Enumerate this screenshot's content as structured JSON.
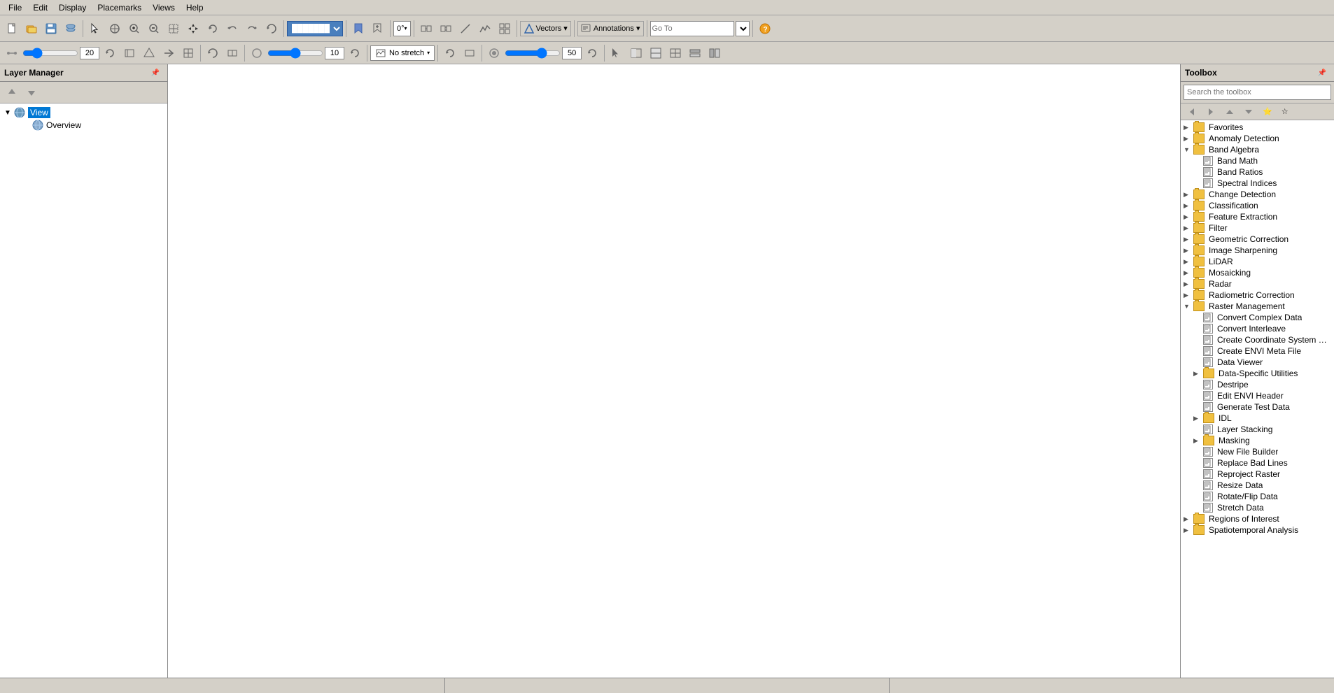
{
  "menubar": {
    "items": [
      "File",
      "Edit",
      "Display",
      "Placemarks",
      "Views",
      "Help"
    ]
  },
  "toolbar1": {
    "combo_blue": "████",
    "angle_label": "0°",
    "vectors_label": "Vectors ▾",
    "annotations_label": "Annotations ▾",
    "goto_label": "Go To",
    "goto_placeholder": ""
  },
  "toolbar2": {
    "slider1_val": "20",
    "stretch_label": "No stretch",
    "slider2_val": "10",
    "slider3_val": "50"
  },
  "layer_manager": {
    "title": "Layer Manager",
    "nodes": [
      {
        "id": "view",
        "label": "View",
        "level": 0,
        "icon": "globe",
        "selected": true,
        "expanded": true
      },
      {
        "id": "overview",
        "label": "Overview",
        "level": 1,
        "icon": "globe-small",
        "selected": false
      }
    ]
  },
  "toolbox": {
    "title": "Toolbox",
    "search_placeholder": "Search the toolbox",
    "items": [
      {
        "id": "favorites",
        "label": "Favorites",
        "level": 0,
        "type": "folder",
        "expanded": false
      },
      {
        "id": "anomaly",
        "label": "Anomaly Detection",
        "level": 0,
        "type": "folder",
        "expanded": false
      },
      {
        "id": "band_algebra",
        "label": "Band Algebra",
        "level": 0,
        "type": "folder",
        "expanded": true
      },
      {
        "id": "band_math",
        "label": "Band Math",
        "level": 1,
        "type": "tool"
      },
      {
        "id": "band_ratios",
        "label": "Band Ratios",
        "level": 1,
        "type": "tool"
      },
      {
        "id": "spectral_indices",
        "label": "Spectral Indices",
        "level": 1,
        "type": "tool"
      },
      {
        "id": "change_detection",
        "label": "Change Detection",
        "level": 0,
        "type": "folder",
        "expanded": false
      },
      {
        "id": "classification",
        "label": "Classification",
        "level": 0,
        "type": "folder",
        "expanded": false
      },
      {
        "id": "feature_extraction",
        "label": "Feature Extraction",
        "level": 0,
        "type": "folder",
        "expanded": false
      },
      {
        "id": "filter",
        "label": "Filter",
        "level": 0,
        "type": "folder",
        "expanded": false
      },
      {
        "id": "geometric_correction",
        "label": "Geometric Correction",
        "level": 0,
        "type": "folder",
        "expanded": false
      },
      {
        "id": "image_sharpening",
        "label": "Image Sharpening",
        "level": 0,
        "type": "folder",
        "expanded": false
      },
      {
        "id": "lidar",
        "label": "LiDAR",
        "level": 0,
        "type": "folder",
        "expanded": false
      },
      {
        "id": "mosaicking",
        "label": "Mosaicking",
        "level": 0,
        "type": "folder",
        "expanded": false
      },
      {
        "id": "radar",
        "label": "Radar",
        "level": 0,
        "type": "folder",
        "expanded": false
      },
      {
        "id": "radiometric_correction",
        "label": "Radiometric Correction",
        "level": 0,
        "type": "folder",
        "expanded": false
      },
      {
        "id": "raster_management",
        "label": "Raster Management",
        "level": 0,
        "type": "folder",
        "expanded": true
      },
      {
        "id": "convert_complex",
        "label": "Convert Complex Data",
        "level": 1,
        "type": "tool"
      },
      {
        "id": "convert_interleave",
        "label": "Convert Interleave",
        "level": 1,
        "type": "tool"
      },
      {
        "id": "create_coordinate",
        "label": "Create Coordinate System St...",
        "level": 1,
        "type": "tool"
      },
      {
        "id": "create_envi_meta",
        "label": "Create ENVI Meta File",
        "level": 1,
        "type": "tool"
      },
      {
        "id": "data_viewer",
        "label": "Data Viewer",
        "level": 1,
        "type": "tool"
      },
      {
        "id": "data_specific",
        "label": "Data-Specific Utilities",
        "level": 1,
        "type": "folder",
        "expanded": false
      },
      {
        "id": "destripe",
        "label": "Destripe",
        "level": 1,
        "type": "tool"
      },
      {
        "id": "edit_envi_header",
        "label": "Edit ENVI Header",
        "level": 1,
        "type": "tool"
      },
      {
        "id": "generate_test",
        "label": "Generate Test Data",
        "level": 1,
        "type": "tool"
      },
      {
        "id": "idl",
        "label": "IDL",
        "level": 1,
        "type": "folder",
        "expanded": false
      },
      {
        "id": "layer_stacking",
        "label": "Layer Stacking",
        "level": 1,
        "type": "tool"
      },
      {
        "id": "masking",
        "label": "Masking",
        "level": 1,
        "type": "folder",
        "expanded": false
      },
      {
        "id": "new_file_builder",
        "label": "New File Builder",
        "level": 1,
        "type": "tool"
      },
      {
        "id": "replace_bad_lines",
        "label": "Replace Bad Lines",
        "level": 1,
        "type": "tool"
      },
      {
        "id": "reproject_raster",
        "label": "Reproject Raster",
        "level": 1,
        "type": "tool"
      },
      {
        "id": "resize_data",
        "label": "Resize Data",
        "level": 1,
        "type": "tool"
      },
      {
        "id": "rotate_flip",
        "label": "Rotate/Flip Data",
        "level": 1,
        "type": "tool"
      },
      {
        "id": "stretch_data",
        "label": "Stretch Data",
        "level": 1,
        "type": "tool"
      },
      {
        "id": "regions_of_interest",
        "label": "Regions of Interest",
        "level": 0,
        "type": "folder",
        "expanded": false
      },
      {
        "id": "spatiotemporal",
        "label": "Spatiotemporal Analysis",
        "level": 0,
        "type": "folder",
        "expanded": false
      }
    ]
  },
  "statusbar": {
    "panes": [
      "",
      "",
      ""
    ]
  }
}
